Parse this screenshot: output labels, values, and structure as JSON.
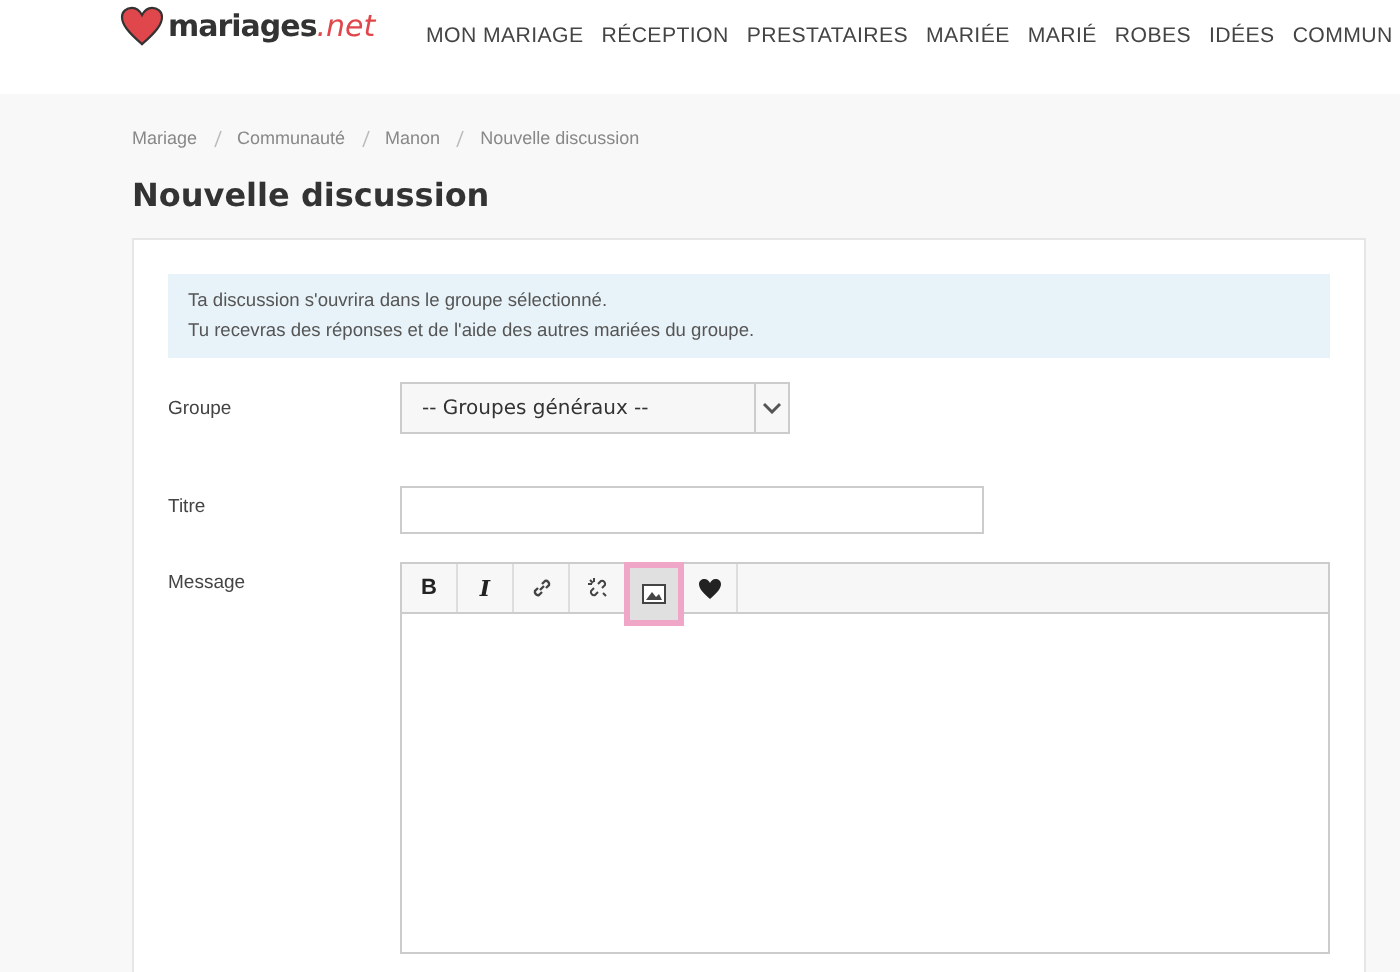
{
  "header": {
    "logo": {
      "text": "mariages",
      "suffix": ".net"
    },
    "nav": [
      "MON MARIAGE",
      "RÉCEPTION",
      "PRESTATAIRES",
      "MARIÉE",
      "MARIÉ",
      "ROBES",
      "IDÉES",
      "COMMUN"
    ]
  },
  "breadcrumb": [
    "Mariage",
    "Communauté",
    "Manon",
    "Nouvelle discussion"
  ],
  "page_title": "Nouvelle discussion",
  "info": [
    "Ta discussion s'ouvrira dans le groupe sélectionné.",
    "Tu recevras des réponses et de l'aide des autres mariées du groupe."
  ],
  "form": {
    "group": {
      "label": "Groupe",
      "value": "-- Groupes généraux --"
    },
    "title": {
      "label": "Titre"
    },
    "message": {
      "label": "Message",
      "toolbar": [
        {
          "kind": "bold",
          "text": "B",
          "highlighted": false
        },
        {
          "kind": "italic",
          "text": "I",
          "highlighted": false
        },
        {
          "kind": "link",
          "highlighted": false
        },
        {
          "kind": "unlink",
          "highlighted": false
        },
        {
          "kind": "image",
          "highlighted": true
        },
        {
          "kind": "heart",
          "highlighted": false
        }
      ]
    }
  }
}
